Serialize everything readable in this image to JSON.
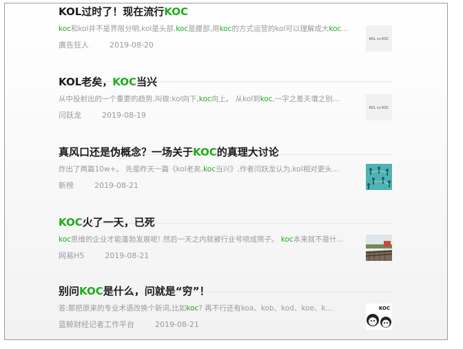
{
  "articles": [
    {
      "title": [
        {
          "text": "KOL过时了！现在流行",
          "hl": false
        },
        {
          "text": "KOC",
          "hl": true
        }
      ],
      "summary": [
        {
          "text": "koc",
          "hl": true
        },
        {
          "text": "和kol并不是界限分明,kol是头部,",
          "hl": false
        },
        {
          "text": "koc",
          "hl": true
        },
        {
          "text": "是腰部,用",
          "hl": false
        },
        {
          "text": "koc",
          "hl": true
        },
        {
          "text": "的方式运营的kol可以理解成大",
          "hl": false
        },
        {
          "text": "koc",
          "hl": true
        },
        {
          "text": "...",
          "hl": false
        }
      ],
      "source": "廣告狂人",
      "date": "2019-08-20",
      "thumb": "kol-vs-koc-thumbnail"
    },
    {
      "title": [
        {
          "text": "KOL老矣，",
          "hl": false
        },
        {
          "text": "KOC",
          "hl": true
        },
        {
          "text": "当兴",
          "hl": false
        }
      ],
      "summary": [
        {
          "text": "从中投射出的一个重要的趋势,叫做:kol向下,",
          "hl": false
        },
        {
          "text": "koc",
          "hl": true
        },
        {
          "text": "向上。 从kol到",
          "hl": false
        },
        {
          "text": "koc",
          "hl": true
        },
        {
          "text": ",一字之差天壤之别...",
          "hl": false
        }
      ],
      "source": "闫跃龙",
      "date": "2019-08-19",
      "thumb": "kol-vs-koc-thumbnail"
    },
    {
      "title": [
        {
          "text": "真风口还是伪概念？一场关于",
          "hl": false
        },
        {
          "text": "KOC",
          "hl": true
        },
        {
          "text": "的真理大讨论",
          "hl": false
        }
      ],
      "summary": [
        {
          "text": "炸出了两篇10w+。 先是昨天一篇《kol老矣,",
          "hl": false
        },
        {
          "text": "koc",
          "hl": true
        },
        {
          "text": "当兴》,作者闫跃龙认为,kol相对更头...",
          "hl": false
        }
      ],
      "source": "新榜",
      "date": "2019-08-21",
      "thumb": "people-network-thumbnail"
    },
    {
      "title": [
        {
          "text": "KOC",
          "hl": true
        },
        {
          "text": "火了一天，已死",
          "hl": false
        }
      ],
      "summary": [
        {
          "text": "koc",
          "hl": true
        },
        {
          "text": "思维的企业才能蓬勃发展呢! 然后一天之内就被行业号喷成筛子。 ",
          "hl": false
        },
        {
          "text": "koc",
          "hl": true
        },
        {
          "text": "本来就不是什...",
          "hl": false
        }
      ],
      "source": "网易H5",
      "date": "2019-08-21",
      "thumb": "railway-thumbnail"
    },
    {
      "title": [
        {
          "text": "别问",
          "hl": false
        },
        {
          "text": "KOC",
          "hl": true
        },
        {
          "text": "是什么，问就是“穷”！",
          "hl": false
        }
      ],
      "summary": [
        {
          "text": "答:那把原来的专业术语改换个新词,比如",
          "hl": false
        },
        {
          "text": "koc",
          "hl": true
        },
        {
          "text": "? 再不行还有koa、kob、kod、koe、k...",
          "hl": false
        }
      ],
      "source": "蓝鲸财经记者工作平台",
      "date": "2019-08-21",
      "thumb": "koc-meme-thumbnail"
    }
  ],
  "thumb_labels": {
    "kol_vs_koc": "KOL vs KOC",
    "koc": "KOC"
  },
  "colors": {
    "highlight": "#1aad19",
    "title": "#1a1a1a",
    "muted": "#9a9a9a",
    "divider": "#e6e6e6"
  }
}
